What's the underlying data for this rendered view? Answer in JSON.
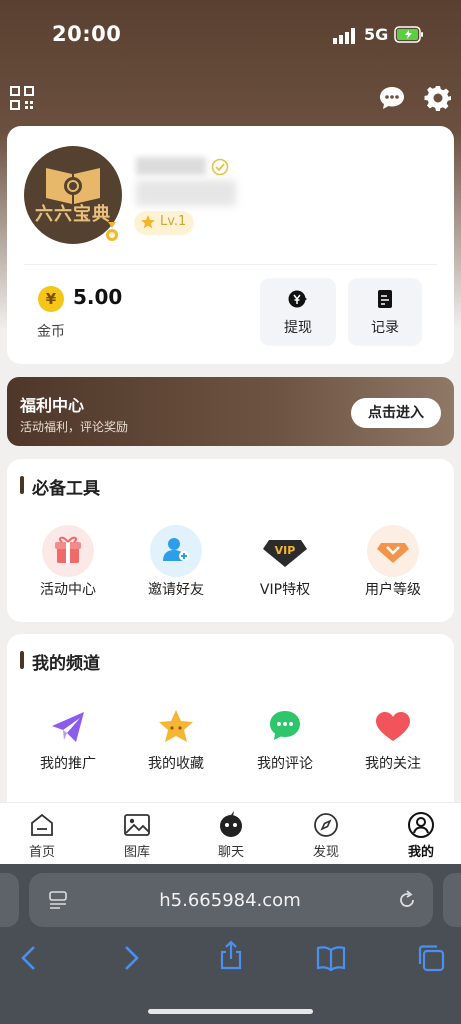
{
  "status_bar": {
    "time": "20:00",
    "network": "5G"
  },
  "profile": {
    "avatar_text": "六六宝典",
    "level": "Lv.1",
    "coins_value": "5.00",
    "coins_label": "金币",
    "withdraw_label": "提现",
    "records_label": "记录",
    "coin_symbol": "¥"
  },
  "welfare": {
    "title": "福利中心",
    "subtitle": "活动福利，评论奖励",
    "button": "点击进入"
  },
  "tools": {
    "title": "必备工具",
    "items": [
      {
        "label": "活动中心",
        "icon": "gift-icon"
      },
      {
        "label": "邀请好友",
        "icon": "invite-user-icon"
      },
      {
        "label": "VIP特权",
        "icon": "vip-diamond-icon"
      },
      {
        "label": "用户等级",
        "icon": "level-diamond-icon"
      }
    ]
  },
  "channels": {
    "title": "我的频道",
    "items": [
      {
        "label": "我的推广",
        "icon": "paper-plane-icon"
      },
      {
        "label": "我的收藏",
        "icon": "star-icon"
      },
      {
        "label": "我的评论",
        "icon": "comment-icon"
      },
      {
        "label": "我的关注",
        "icon": "heart-icon"
      }
    ]
  },
  "tabbar": [
    {
      "label": "首页",
      "icon": "home-icon"
    },
    {
      "label": "图库",
      "icon": "gallery-icon"
    },
    {
      "label": "聊天",
      "icon": "chat-bubble-icon"
    },
    {
      "label": "发现",
      "icon": "compass-icon"
    },
    {
      "label": "我的",
      "icon": "user-icon",
      "active": true
    }
  ],
  "browser": {
    "url": "h5.665984.com"
  },
  "colors": {
    "brand_brown": "#5a4030",
    "coin_yellow": "#f5c518",
    "level_gold": "#d3a33a"
  }
}
